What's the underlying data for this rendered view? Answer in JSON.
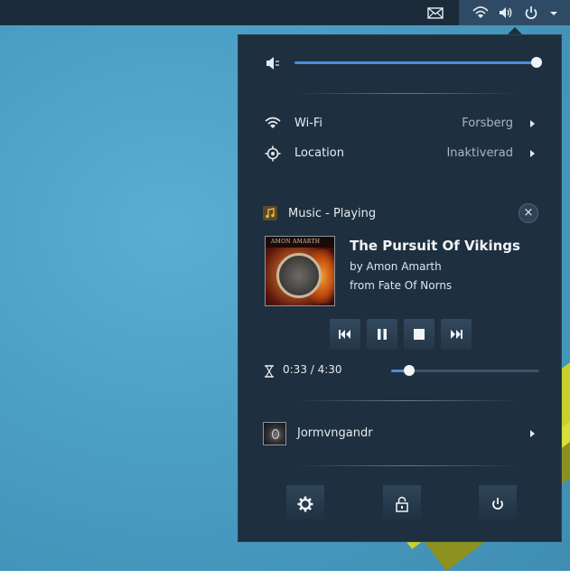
{
  "topbar": {
    "icons": [
      "mail-icon",
      "wifi-icon",
      "volume-icon",
      "power-icon",
      "dropdown-arrow-icon"
    ]
  },
  "volume": {
    "icon": "volume-muted-icon",
    "level": 1.0
  },
  "network": {
    "wifi_label": "Wi-Fi",
    "wifi_value": "Forsberg",
    "location_label": "Location",
    "location_value": "Inaktiverad"
  },
  "music": {
    "header": "Music - Playing",
    "title": "The Pursuit Of Vikings",
    "artist": "by Amon Amarth",
    "album": "from Fate Of Norns",
    "album_band_text": "AMON AMARTH",
    "time": "0:33 / 4:30",
    "progress": 0.122,
    "controls": [
      "previous",
      "pause",
      "stop",
      "next"
    ]
  },
  "user": {
    "name": "Jormvngandr"
  },
  "bottom_buttons": [
    "settings",
    "lock",
    "power-off"
  ],
  "colors": {
    "accent": "#4a8de0",
    "menu_bg": "#1e2f3f",
    "topbar_bg": "#1c2b3a"
  }
}
